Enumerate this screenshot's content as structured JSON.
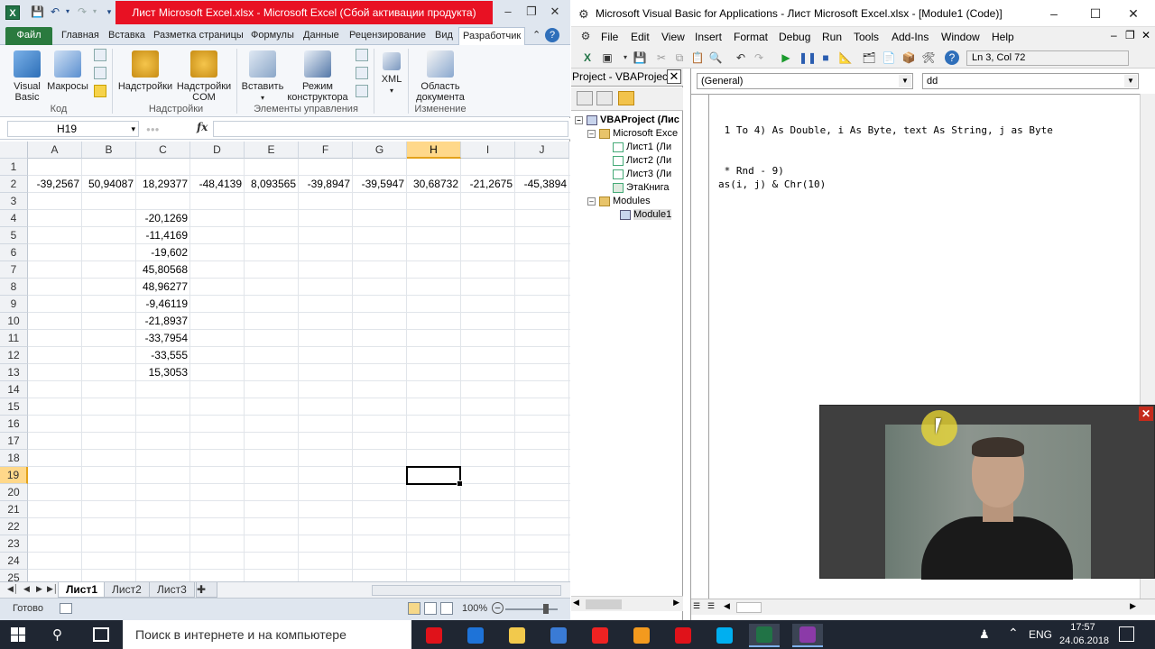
{
  "excel": {
    "window_title": "Лист Microsoft Excel.xlsx  -  Microsoft Excel (Сбой активации продукта)",
    "ribbon_tabs": [
      "Файл",
      "Главная",
      "Вставка",
      "Разметка страницы",
      "Формулы",
      "Данные",
      "Рецензирование",
      "Вид",
      "Разработчик"
    ],
    "active_tab": "Разработчик",
    "ribbon": {
      "visual_basic": "Visual Basic",
      "macros": "Макросы",
      "group_code": "Код",
      "addins": "Надстройки",
      "com_addins": "Надстройки COM",
      "group_addins": "Надстройки",
      "insert": "Вставить",
      "design_mode": "Режим конструктора",
      "group_controls": "Элементы управления",
      "xml": "XML",
      "document_panel": "Область документа",
      "group_modify": "Изменение"
    },
    "name_box": "H19",
    "fx": "fx",
    "columns": [
      "A",
      "B",
      "C",
      "D",
      "E",
      "F",
      "G",
      "H",
      "I",
      "J"
    ],
    "selected_column": "H",
    "rows": [
      "1",
      "2",
      "3",
      "4",
      "5",
      "6",
      "7",
      "8",
      "9",
      "10",
      "11",
      "12",
      "13",
      "14",
      "15",
      "16",
      "17",
      "18",
      "19",
      "20",
      "21",
      "22",
      "23",
      "24",
      "25"
    ],
    "selected_row": "19",
    "row2_values": [
      "-39,2567",
      "50,94087",
      "18,29377",
      "-48,4139",
      "8,093565",
      "-39,8947",
      "-39,5947",
      "30,68732",
      "-21,2675",
      "-45,3894"
    ],
    "colC_values": [
      "-20,1269",
      "-11,4169",
      "-19,602",
      "45,80568",
      "48,96277",
      "-9,46119",
      "-21,8937",
      "-33,7954",
      "-33,555",
      "15,3053"
    ],
    "sheets": [
      "Лист1",
      "Лист2",
      "Лист3"
    ],
    "active_sheet": "Лист1",
    "status": "Готово",
    "zoom": "100%"
  },
  "vbe": {
    "window_title": "Microsoft Visual Basic for Applications - Лист Microsoft Excel.xlsx - [Module1 (Code)]",
    "menu": [
      "File",
      "Edit",
      "View",
      "Insert",
      "Format",
      "Debug",
      "Run",
      "Tools",
      "Add-Ins",
      "Window",
      "Help"
    ],
    "cursor_pos": "Ln 3, Col 72",
    "project_title": "Project - VBAProject",
    "tree": {
      "root": "VBAProject (Лис",
      "excel_objects": "Microsoft Exce",
      "sheet1": "Лист1 (Ли",
      "sheet2": "Лист2 (Ли",
      "sheet3": "Лист3 (Ли",
      "thisbook": "ЭтаКнига",
      "modules": "Modules",
      "module1": "Module1"
    },
    "combo_left": "(General)",
    "combo_right": "dd",
    "code_lines": [
      " 1 To 4) As Double, i As Byte, text As String, j as Byte",
      " * Rnd - 9)",
      "as(i, j) & Chr(10)"
    ]
  },
  "taskbar": {
    "search_placeholder": "Поиск в интернете и на компьютере",
    "lang": "ENG",
    "time": "17:57",
    "date": "24.06.2018",
    "apps": [
      {
        "name": "opera-icon",
        "color": "#e0121a"
      },
      {
        "name": "edge-icon",
        "color": "#1e73d8"
      },
      {
        "name": "file-explorer-icon",
        "color": "#f2c94c"
      },
      {
        "name": "app-icon",
        "color": "#3a7bd5"
      },
      {
        "name": "yandex-icon",
        "color": "#e22"
      },
      {
        "name": "app-orange-icon",
        "color": "#f39a1e"
      },
      {
        "name": "opera-icon-2",
        "color": "#e0121a"
      },
      {
        "name": "skype-icon",
        "color": "#00aff0"
      },
      {
        "name": "excel-icon",
        "color": "#217346"
      },
      {
        "name": "media-icon",
        "color": "#8b3aa8"
      }
    ]
  }
}
